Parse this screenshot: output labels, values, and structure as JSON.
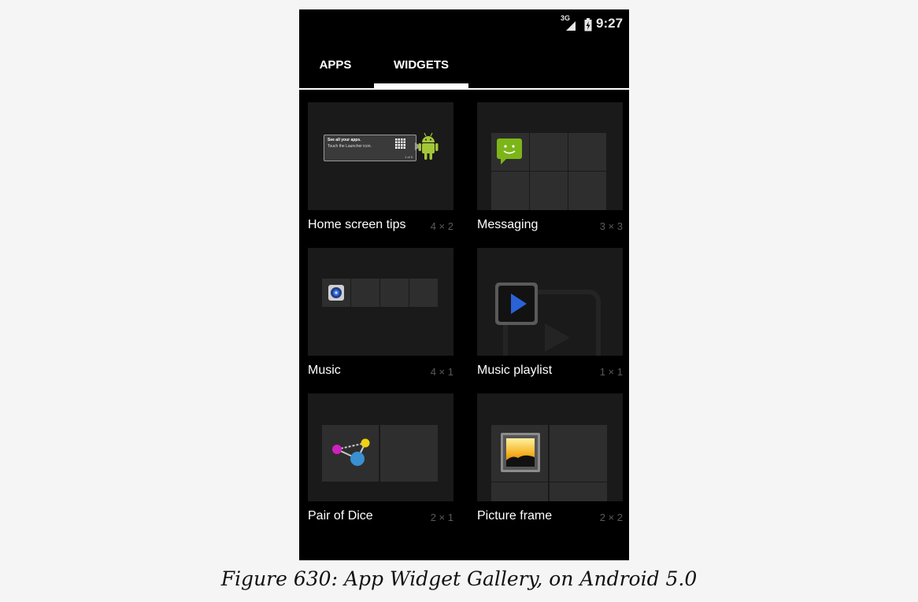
{
  "status_bar": {
    "network": "3G",
    "time": "9:27"
  },
  "tabs": [
    {
      "label": "APPS",
      "selected": false
    },
    {
      "label": "WIDGETS",
      "selected": true
    }
  ],
  "widgets": [
    {
      "name": "Home screen tips",
      "size": "4 × 2",
      "preview": {
        "line1": "See all your apps.",
        "line2": "Touch the Launcher icon.",
        "pager": "1 of 5"
      }
    },
    {
      "name": "Messaging",
      "size": "3 × 3"
    },
    {
      "name": "Music",
      "size": "4 × 1"
    },
    {
      "name": "Music playlist",
      "size": "1 × 1"
    },
    {
      "name": "Pair of Dice",
      "size": "2 × 1"
    },
    {
      "name": "Picture frame",
      "size": "2 × 2"
    }
  ],
  "caption": "Figure 630: App Widget Gallery, on Android 5.0",
  "colors": {
    "screen": "#000000",
    "preview_bg": "#1a1a1a",
    "cell": "#2e2e2e",
    "size_text": "#5a5a5a",
    "page_bg": "#f5f5f5"
  }
}
